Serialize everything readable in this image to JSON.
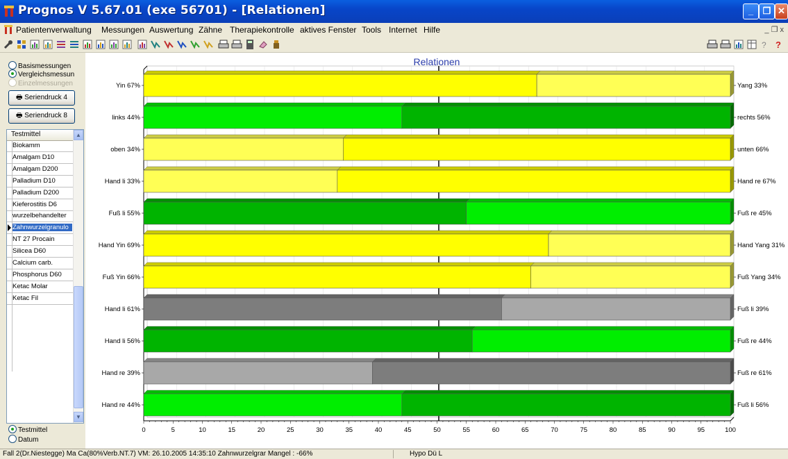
{
  "window": {
    "title": "Prognos V 5.67.01  (exe 56701) - [Relationen]",
    "controls": {
      "minimize": "_",
      "restore": "❐",
      "close": "✕"
    }
  },
  "menu": {
    "items": [
      {
        "label": "Patientenverwaltung"
      },
      {
        "label": "Messungen"
      },
      {
        "label": "Auswertung"
      },
      {
        "label": "Zähne"
      },
      {
        "label": "Therapiekontrolle"
      },
      {
        "label": "aktives Fenster"
      },
      {
        "label": "Tools"
      },
      {
        "label": "Internet"
      },
      {
        "label": "Hilfe"
      }
    ],
    "mdi_controls": "_ ❐ x"
  },
  "toolbar": {
    "left_icons": [
      "tool-icon",
      "grid-icon",
      "chart-icon",
      "chart-icon",
      "list-icon",
      "list-icon",
      "chart-icon",
      "chart-icon",
      "bar-icon",
      "chart-icon",
      "chart-icon",
      "curve-icon",
      "curve-icon",
      "curve-icon",
      "curve-icon",
      "curve-icon",
      "print-icon",
      "print-icon",
      "calculator-icon",
      "eraser-icon",
      "person-icon"
    ],
    "right_icons": [
      "print-icon",
      "print-preview-icon",
      "chart-icon",
      "table-icon",
      "help-icon",
      "question-icon"
    ]
  },
  "left_panel": {
    "radio_basis": "Basismessungen",
    "radio_vergleich": "Vergleichsmessun",
    "radio_einzel": "Einzelmessungen",
    "btn_serien4": "Seriendruck 4",
    "btn_serien8": "Seriendruck 8",
    "list_header": "Testmittel",
    "list_items": [
      "Biokamm",
      "Amalgam D10",
      "Amalgam D200",
      "Palladium D10",
      "Palladium D200",
      "Kieferostitis D6",
      "wurzelbehandelter",
      "Zahnwurzelgranulo",
      "NT 27 Procain",
      "Silicea D60",
      "Calcium carb.",
      "Phosphorus D60",
      "Ketac Molar",
      "Ketac Fil"
    ],
    "selected_index": 7,
    "radio_testmittel": "Testmittel",
    "radio_datum": "Datum"
  },
  "chart_data": {
    "type": "bar",
    "title": "Relationen",
    "stacked": true,
    "orientation": "horizontal",
    "xlim": [
      0,
      100
    ],
    "xticks": [
      0,
      5,
      10,
      15,
      20,
      25,
      30,
      35,
      40,
      45,
      50,
      55,
      60,
      65,
      70,
      75,
      80,
      85,
      90,
      95,
      100
    ],
    "rows": [
      {
        "left_label": "Yin 67%",
        "right_label": "Yang 33%",
        "value": 67,
        "left_color": "#ffff00",
        "right_color": "#ffff55"
      },
      {
        "left_label": "links 44%",
        "right_label": "rechts 56%",
        "value": 44,
        "left_color": "#00ee00",
        "right_color": "#00b400"
      },
      {
        "left_label": "oben 34%",
        "right_label": "unten 66%",
        "value": 34,
        "left_color": "#ffff55",
        "right_color": "#ffff00"
      },
      {
        "left_label": "Hand li 33%",
        "right_label": "Hand re 67%",
        "value": 33,
        "left_color": "#ffff55",
        "right_color": "#ffff00"
      },
      {
        "left_label": "Fuß li 55%",
        "right_label": "Fuß re 45%",
        "value": 55,
        "left_color": "#00b400",
        "right_color": "#00ee00"
      },
      {
        "left_label": "Hand Yin 69%",
        "right_label": "Hand Yang 31%",
        "value": 69,
        "left_color": "#ffff00",
        "right_color": "#ffff55"
      },
      {
        "left_label": "Fuß Yin 66%",
        "right_label": "Fuß Yang 34%",
        "value": 66,
        "left_color": "#ffff00",
        "right_color": "#ffff55"
      },
      {
        "left_label": "Hand li 61%",
        "right_label": "Fuß li 39%",
        "value": 61,
        "left_color": "#7d7d7d",
        "right_color": "#a8a8a8"
      },
      {
        "left_label": "Hand li 56%",
        "right_label": "Fuß re 44%",
        "value": 56,
        "left_color": "#00b400",
        "right_color": "#00ee00"
      },
      {
        "left_label": "Hand re 39%",
        "right_label": "Fuß re 61%",
        "value": 39,
        "left_color": "#a8a8a8",
        "right_color": "#7d7d7d"
      },
      {
        "left_label": "Hand re 44%",
        "right_label": "Fuß li 56%",
        "value": 44,
        "left_color": "#00ee00",
        "right_color": "#00b400"
      }
    ]
  },
  "status": {
    "left": "Fall 2(Dr.Niestegge) Ma Ca(80%Verb.NT.7) VM: 26.10.2005 14:35:10  Zahnwurzelgrar Mangel : -66%",
    "right": "Hypo Dü L"
  }
}
